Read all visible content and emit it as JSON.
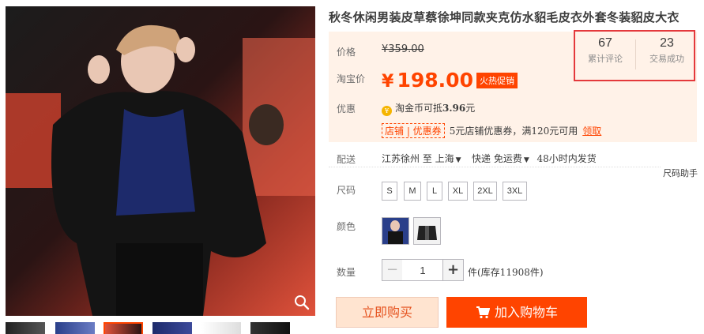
{
  "product": {
    "title": "秋冬休闲男装皮草蔡徐坤同款夹克仿水貂毛皮衣外套冬装貂皮大衣"
  },
  "price": {
    "label": "价格",
    "original": "¥359.00",
    "promo_label": "淘宝价",
    "promo_currency": "¥",
    "promo_value": "198.00",
    "promo_badge": "火热促销"
  },
  "offers": {
    "label": "优惠",
    "coin_text_prefix": "淘金币可抵",
    "coin_amount": "3.96",
    "coin_text_suffix": "元",
    "coupon_tag": "店铺 | 优惠券",
    "coupon_text": "5元店铺优惠券，满120元可用",
    "coupon_claim": "领取"
  },
  "stats": {
    "reviews_count": "67",
    "reviews_label": "累计评论",
    "sales_count": "23",
    "sales_label": "交易成功"
  },
  "shipping": {
    "label": "配送",
    "from": "江苏徐州 至",
    "to": "上海",
    "method": "快递 免运费",
    "dispatch": "48小时内发货"
  },
  "size_helper": "尺码助手",
  "sizes": {
    "label": "尺码",
    "options": [
      "S",
      "M",
      "L",
      "XL",
      "2XL",
      "3XL"
    ]
  },
  "colors": {
    "label": "颜色",
    "options": [
      "color-option-1",
      "color-option-2"
    ]
  },
  "quantity": {
    "label": "数量",
    "value": "1",
    "minus": "−",
    "plus": "+",
    "stock": "件(库存11908件)"
  },
  "actions": {
    "buy_now": "立即购买",
    "add_to_cart": "加入购物车"
  },
  "theme": {
    "accent": "#ff4400",
    "highlight_border": "#e4393c",
    "price_panel_bg": "#fff2e8"
  }
}
